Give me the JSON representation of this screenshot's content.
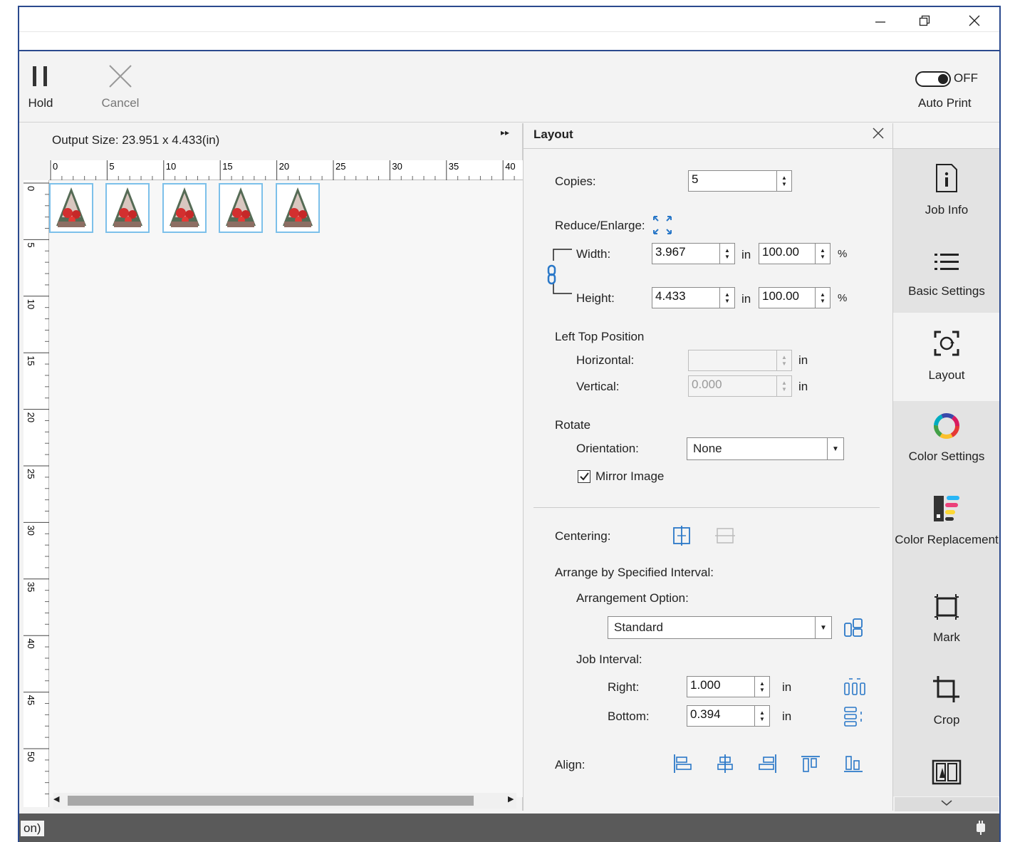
{
  "window": {
    "minimize_icon": "minimize-icon",
    "restore_icon": "restore-icon",
    "close_icon": "close-icon"
  },
  "toolbar": {
    "hold_label": "Hold",
    "cancel_label": "Cancel",
    "auto_print_label": "Auto Print",
    "auto_print_state": "OFF"
  },
  "preview": {
    "output_size_label": "Output Size:",
    "output_size_value": "23.951 x 4.433(in)",
    "h_ticks": [
      "0",
      "5",
      "10",
      "15",
      "20",
      "25",
      "30",
      "35",
      "40"
    ],
    "v_ticks": [
      "0",
      "5",
      "10",
      "15",
      "20",
      "25",
      "30",
      "35",
      "40",
      "45",
      "50"
    ],
    "copies_shown": 5
  },
  "panel": {
    "title": "Layout",
    "copies_label": "Copies:",
    "copies_value": "5",
    "reduce_enlarge_label": "Reduce/Enlarge:",
    "width_label": "Width:",
    "width_value": "3.967",
    "width_unit": "in",
    "width_pct": "100.00",
    "pct_unit": "%",
    "height_label": "Height:",
    "height_value": "4.433",
    "height_unit": "in",
    "height_pct": "100.00",
    "left_top_label": "Left Top Position",
    "horizontal_label": "Horizontal:",
    "horizontal_value": "",
    "horizontal_unit": "in",
    "vertical_label": "Vertical:",
    "vertical_value": "0.000",
    "vertical_unit": "in",
    "rotate_label": "Rotate",
    "orientation_label": "Orientation:",
    "orientation_value": "None",
    "mirror_label": "Mirror Image",
    "mirror_checked": true,
    "centering_label": "Centering:",
    "arrange_label": "Arrange by Specified Interval:",
    "arrangement_option_label": "Arrangement Option:",
    "arrangement_value": "Standard",
    "job_interval_label": "Job Interval:",
    "right_label": "Right:",
    "right_value": "1.000",
    "right_unit": "in",
    "bottom_label": "Bottom:",
    "bottom_value": "0.394",
    "bottom_unit": "in",
    "align_label": "Align:"
  },
  "sidebar": {
    "items": [
      {
        "label": "Job Info",
        "icon": "info-icon"
      },
      {
        "label": "Basic Settings",
        "icon": "list-icon"
      },
      {
        "label": "Layout",
        "icon": "layout-icon"
      },
      {
        "label": "Color Settings",
        "icon": "color-wheel-icon"
      },
      {
        "label": "Color Replacement",
        "icon": "color-replacement-icon"
      },
      {
        "label": "Mark",
        "icon": "mark-icon"
      },
      {
        "label": "Crop",
        "icon": "crop-icon"
      },
      {
        "label": "",
        "icon": "tiling-icon"
      }
    ]
  },
  "statusbar": {
    "text": "on)"
  }
}
